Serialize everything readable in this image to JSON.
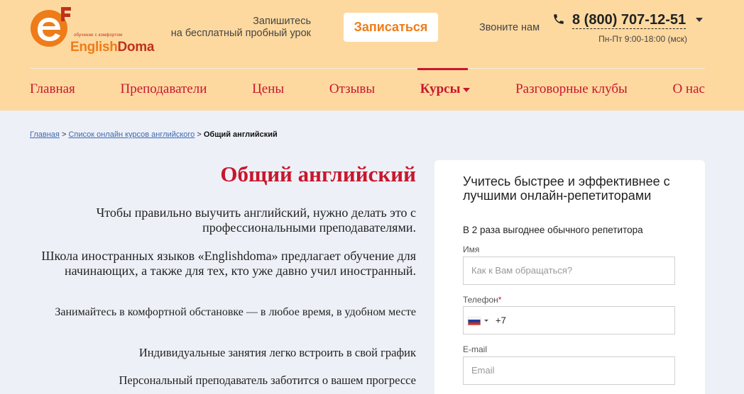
{
  "header": {
    "logo": {
      "tagline": "обучение с комфортом",
      "word_part1": "English",
      "word_part2": "Doma"
    },
    "promo_line1": "Запишитесь",
    "promo_line2": "на бесплатный пробный урок",
    "signup_label": "Записаться",
    "call_label": "Звоните нам",
    "phone": "8 (800) 707-12-51",
    "hours": "Пн-Пт 9:00-18:00 (мск)"
  },
  "nav": {
    "items": [
      "Главная",
      "Преподаватели",
      "Цены",
      "Отзывы",
      "Курсы",
      "Разговорные клубы",
      "О нас"
    ],
    "active": "Курсы"
  },
  "breadcrumb": {
    "home": "Главная",
    "separator": ">",
    "list": "Список онлайн курсов английского",
    "current": "Общий английский"
  },
  "main": {
    "title": "Общий английский",
    "paragraphs": [
      "Чтобы правильно выучить английский, нужно делать это с профессиональными преподавателями.",
      "Школа иностранных языков «Englishdoma» предлагает обучение для начинающих, а также для тех, кто уже давно учил иностранный.",
      "Занимайтесь в комфортной обстановке — в любое время, в удобном месте",
      "Индивидуальные занятия легко встроить в свой график",
      "Персональный преподаватель заботится о вашем прогрессе"
    ]
  },
  "form": {
    "title": "Учитесь быстрее и эффективнее с лучшими онлайн-репетиторами",
    "subtitle": "В 2 раза выгоднее обычного репетитора",
    "name_label": "Имя",
    "name_placeholder": "Как к Вам обращаться?",
    "phone_label": "Телефон",
    "phone_required_mark": "*",
    "phone_prefix": "+7",
    "email_label": "E-mail",
    "email_placeholder": "Email"
  },
  "colors": {
    "header_bg": "#fdd9a0",
    "accent_red": "#c8162c",
    "accent_orange": "#ee7c18",
    "page_bg": "#eef0f7"
  }
}
